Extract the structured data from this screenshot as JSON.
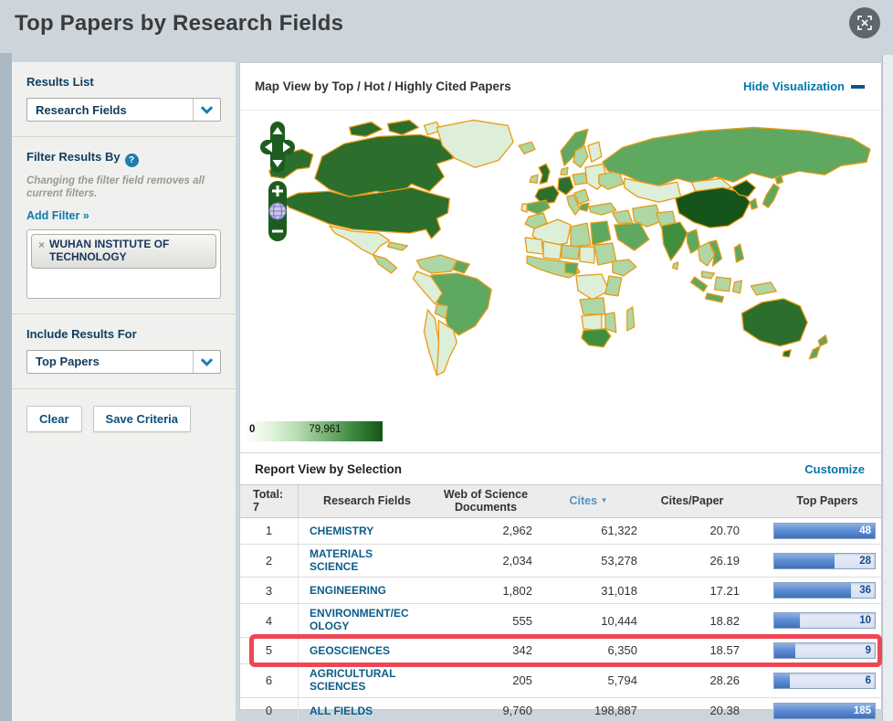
{
  "page": {
    "title": "Top Papers by Research Fields"
  },
  "icons": {
    "help": "?",
    "remove": "×",
    "sort_desc": "▼"
  },
  "sidebar": {
    "results_list_label": "Results List",
    "results_list_value": "Research Fields",
    "filter_heading": "Filter Results By",
    "filter_note": "Changing the filter field removes all current filters.",
    "add_filter": "Add Filter »",
    "filter_chip": {
      "remove_icon": "×",
      "label": "WUHAN INSTITUTE OF TECHNOLOGY"
    },
    "include_label": "Include Results For",
    "include_value": "Top Papers",
    "clear_button": "Clear",
    "save_button": "Save Criteria"
  },
  "map_panel": {
    "title": "Map View by Top / Hot / Highly Cited Papers",
    "hide_link": "Hide Visualization",
    "legend_min": "0",
    "legend_max": "79,961",
    "palette": {
      "min_color": "#ffffff",
      "max_color": "#14541a",
      "country_border": "#e89b15"
    }
  },
  "report": {
    "title": "Report View by Selection",
    "customize": "Customize",
    "highlight_color": "#ee4653",
    "table": {
      "total_label": "Total:",
      "total_value": "7",
      "col_field": "Research Fields",
      "col_docs": "Web of Science Documents",
      "col_cites": "Cites",
      "col_cpp": "Cites/Paper",
      "col_top": "Top Papers",
      "rows": [
        {
          "rank": "1",
          "field": "CHEMISTRY",
          "docs": "2,962",
          "cites": "61,322",
          "cpp": "20.70",
          "top": "48",
          "bar_pct": 100,
          "bar_full": true,
          "highlighted": false
        },
        {
          "rank": "2",
          "field": "MATERIALS SCIENCE",
          "docs": "2,034",
          "cites": "53,278",
          "cpp": "26.19",
          "top": "28",
          "bar_pct": 60,
          "bar_full": false,
          "highlighted": false
        },
        {
          "rank": "3",
          "field": "ENGINEERING",
          "docs": "1,802",
          "cites": "31,018",
          "cpp": "17.21",
          "top": "36",
          "bar_pct": 76,
          "bar_full": false,
          "highlighted": false
        },
        {
          "rank": "4",
          "field": "ENVIRONMENT/ECOLOGY",
          "docs": "555",
          "cites": "10,444",
          "cpp": "18.82",
          "top": "10",
          "bar_pct": 25,
          "bar_full": false,
          "highlighted": false
        },
        {
          "rank": "5",
          "field": "GEOSCIENCES",
          "docs": "342",
          "cites": "6,350",
          "cpp": "18.57",
          "top": "9",
          "bar_pct": 21,
          "bar_full": false,
          "highlighted": true
        },
        {
          "rank": "6",
          "field": "AGRICULTURAL SCIENCES",
          "docs": "205",
          "cites": "5,794",
          "cpp": "28.26",
          "top": "6",
          "bar_pct": 15,
          "bar_full": false,
          "highlighted": false
        },
        {
          "rank": "0",
          "field": "ALL FIELDS",
          "docs": "9,760",
          "cites": "198,887",
          "cpp": "20.38",
          "top": "185",
          "bar_pct": 100,
          "bar_full": true,
          "highlighted": false
        }
      ]
    }
  }
}
